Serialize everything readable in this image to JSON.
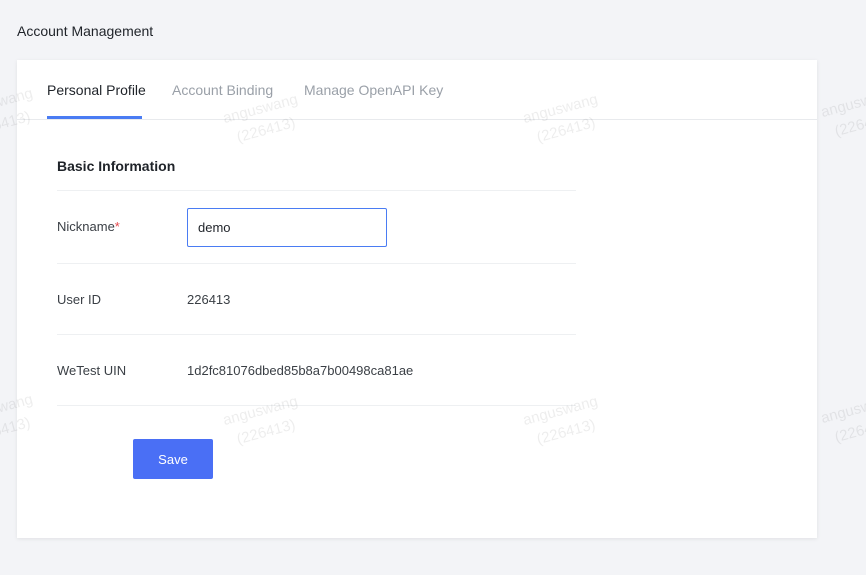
{
  "page": {
    "title": "Account Management"
  },
  "tabs": [
    {
      "label": "Personal Profile",
      "active": true
    },
    {
      "label": "Account Binding",
      "active": false
    },
    {
      "label": "Manage OpenAPI Key",
      "active": false
    }
  ],
  "section": {
    "title": "Basic Information"
  },
  "fields": {
    "nickname": {
      "label": "Nickname",
      "required_mark": "*",
      "value": "demo"
    },
    "user_id": {
      "label": "User ID",
      "value": "226413"
    },
    "wetest_uin": {
      "label": "WeTest UIN",
      "value": "1d2fc81076dbed85b8a7b00498ca81ae"
    }
  },
  "actions": {
    "save_label": "Save"
  },
  "watermark": {
    "name": "anguswang",
    "id": "(226413)"
  },
  "colors": {
    "accent": "#4a7cf3",
    "button": "#4a6ff5",
    "required": "#e5484d"
  }
}
